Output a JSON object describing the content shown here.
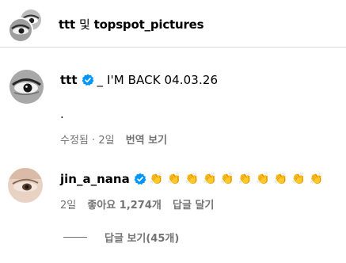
{
  "header": {
    "user1": "ttt",
    "connector": "및",
    "user2": "topspot_pictures"
  },
  "post": {
    "username": "ttt",
    "verified": true,
    "caption": "_ I'M BACK 04.03.26",
    "body": ".",
    "edited": "수정됨",
    "separator": "·",
    "time": "2일",
    "translate": "번역 보기"
  },
  "comment": {
    "username": "jin_a_nana",
    "verified": true,
    "text": "👏👏👏👏👏👏👏👏👏👏",
    "time": "2일",
    "likes": "좋아요 1,274개",
    "reply": "답글 달기"
  },
  "replies": {
    "label": "답글 보기(45개)"
  },
  "colors": {
    "verified_blue": "#0095f6",
    "muted_text": "#737373"
  },
  "icons": {
    "verified": "verified-badge-icon",
    "clap": "clapping-hands-emoji"
  }
}
